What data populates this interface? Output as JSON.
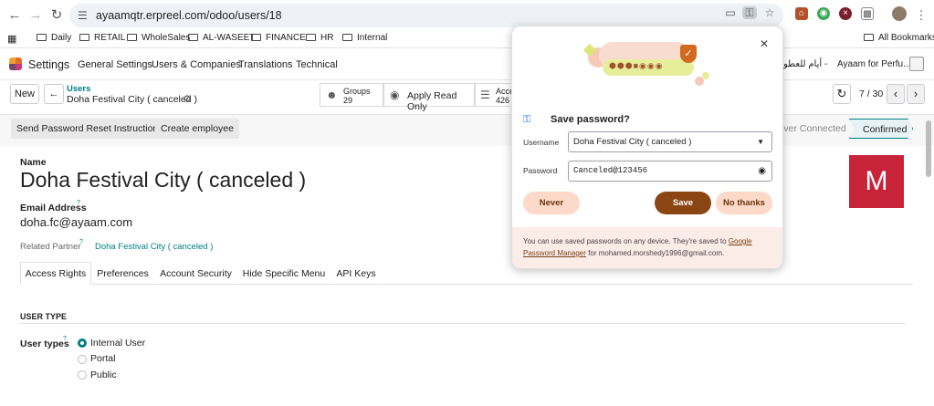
{
  "browser": {
    "url": "ayaamqtr.erpreel.com/odoo/users/18",
    "bookmarks": [
      "Daily",
      "RETAIL",
      "WholeSales",
      "AL-WASEET",
      "FINANCE",
      "HR",
      "Internal"
    ],
    "all_bookmarks": "All Bookmarks"
  },
  "nav": {
    "app": "Settings",
    "items": [
      "General Settings",
      "Users & Companies",
      "Translations",
      "Technical"
    ],
    "company": "Ayaam for Perfu...",
    "company_ar": "أيام للعطو -"
  },
  "control": {
    "new": "New",
    "breadcrumb_parent": "Users",
    "breadcrumb_current": "Doha Festival City ( canceled )",
    "groups_label": "Groups",
    "groups_count": "29",
    "apply_read_only": "Apply Read Only",
    "access_label": "Acce",
    "access_count": "426",
    "pager": "7 / 30"
  },
  "actions": {
    "reset_password": "Send Password Reset Instructions",
    "create_employee": "Create employee",
    "status_never": "Never Connected",
    "status_confirmed": "Confirmed"
  },
  "form": {
    "name_label": "Name",
    "name": "Doha Festival City ( canceled )",
    "email_label": "Email Address",
    "email_help": "?",
    "email": "doha.fc@ayaam.com",
    "related_partner_label": "Related Partner",
    "related_partner_help": "?",
    "related_partner": "Doha Festival City ( canceled )",
    "avatar_letter": "M",
    "tabs": [
      "Access Rights",
      "Preferences",
      "Account Security",
      "Hide Specific Menu",
      "API Keys"
    ],
    "section": "USER TYPE",
    "user_types_label": "User types",
    "user_types_help": "?",
    "user_types": [
      "Internal User",
      "Portal",
      "Public"
    ],
    "selected_user_type": "Internal User"
  },
  "password_popup": {
    "title": "Save password?",
    "username_label": "Username",
    "username": "Doha Festival City ( canceled )",
    "password_label": "Password",
    "password": "Canceled@123456",
    "never": "Never",
    "save": "Save",
    "no_thanks": "No thanks",
    "footer_text": "You can use saved passwords on any device. They're saved to",
    "footer_link1": "Google",
    "footer_link2": "Password Manager",
    "footer_tail": "for mohamed.morshedy1996@gmail.com."
  },
  "colors": {
    "odoo_primary": "#017e84",
    "odoo_purple": "#714b67",
    "avatar_bg": "#c7243a",
    "save_button": "#8b4513",
    "popup_accent": "#f8dccf"
  }
}
